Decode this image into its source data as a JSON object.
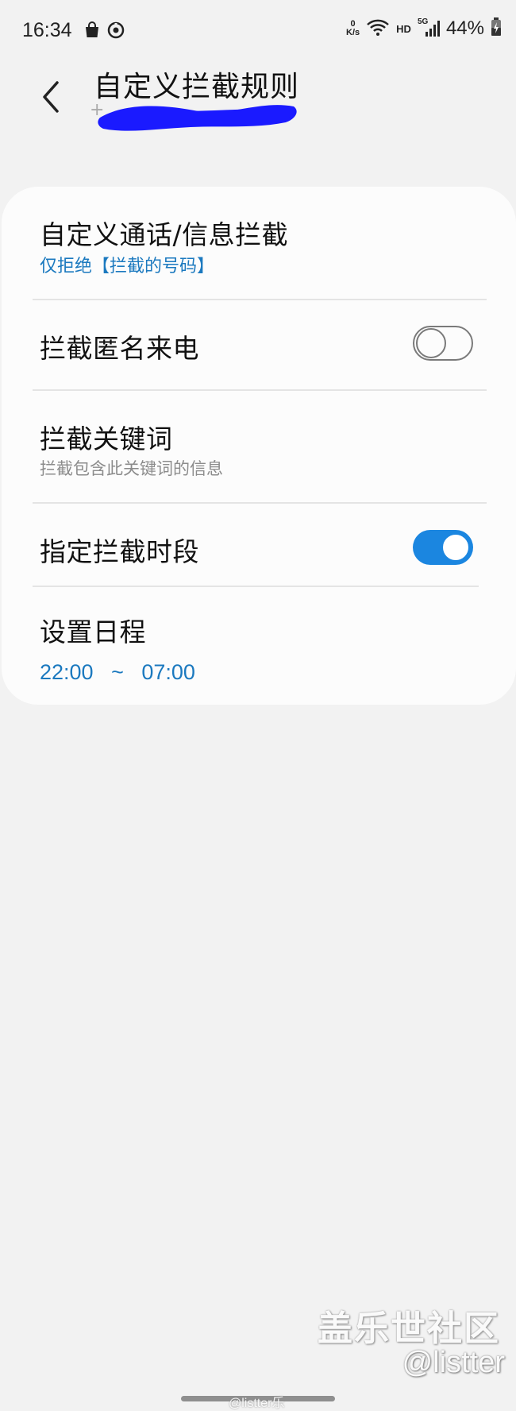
{
  "status_bar": {
    "time": "16:34",
    "net_speed_value": "0",
    "net_speed_unit": "K/s",
    "hd_label": "HD",
    "network_label": "5G",
    "battery": "44%",
    "icons": [
      "shopping-bag-icon",
      "sync-icon",
      "wifi-icon",
      "signal-icon",
      "battery-icon"
    ]
  },
  "header": {
    "title": "自定义拦截规则",
    "subtitle_visible_prefix": "+"
  },
  "settings": {
    "custom_block": {
      "title": "自定义通话/信息拦截",
      "subtitle": "仅拒绝【拦截的号码】"
    },
    "block_anonymous": {
      "title": "拦截匿名来电",
      "enabled": false
    },
    "block_keywords": {
      "title": "拦截关键词",
      "subtitle": "拦截包含此关键词的信息"
    },
    "scheduled_block": {
      "title": "指定拦截时段",
      "enabled": true
    },
    "schedule": {
      "title": "设置日程",
      "time_range": "22:00   ~   07:00"
    }
  },
  "watermarks": {
    "line1": "盖乐世社区",
    "line2": "@listter",
    "line3": "@listter乐"
  },
  "colors": {
    "accent": "#1b86e0",
    "link_blue": "#1b79bf",
    "background": "#f2f2f2",
    "card": "#fcfcfc",
    "redaction": "#1a1aff"
  }
}
